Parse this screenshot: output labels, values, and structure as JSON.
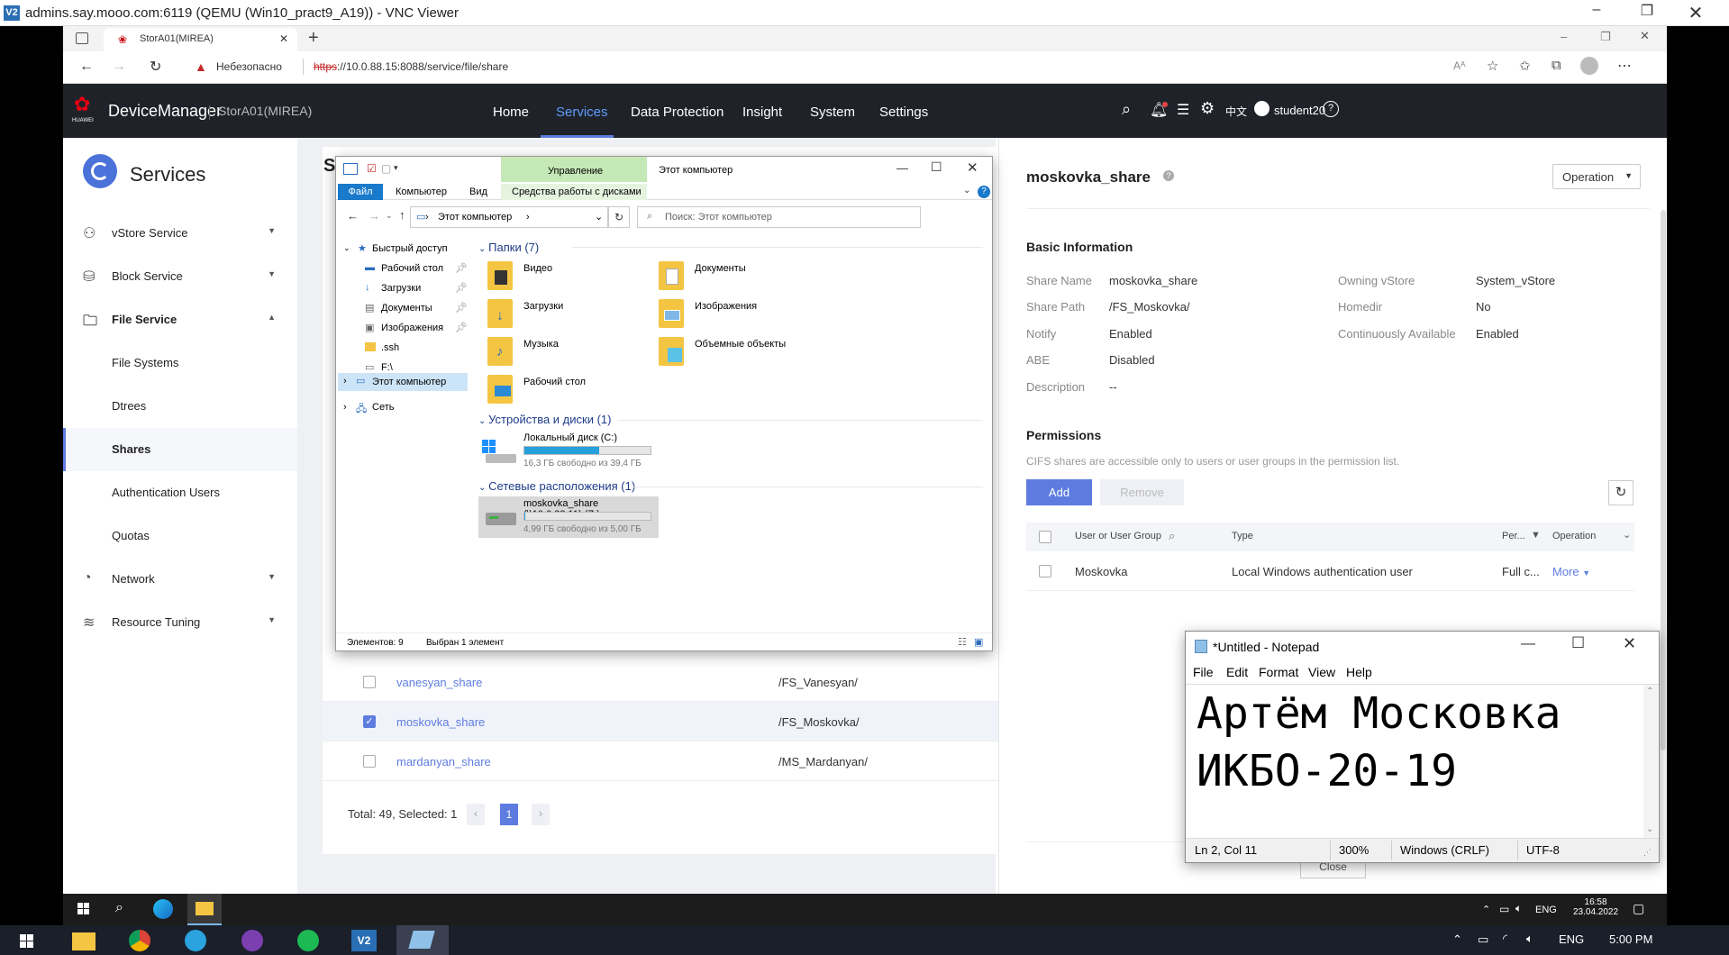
{
  "vnc": {
    "title": "admins.say.mooo.com:6119 (QEMU (Win10_pract9_A19)) - VNC Viewer",
    "icon": "V2"
  },
  "browser": {
    "tab_title": "StorA01(MIREA)",
    "security_label": "Небезопасно",
    "url_scheme": "https",
    "url_rest": "://10.0.88.15:8088/service/file/share"
  },
  "header": {
    "brand": "DeviceManager",
    "huawei": "HUAWEI",
    "device": "StorA01(MIREA)",
    "nav": [
      "Home",
      "Services",
      "Data Protection",
      "Insight",
      "System",
      "Settings"
    ],
    "active_nav": "Services",
    "lang": "中文",
    "user": "student20"
  },
  "sidebar": {
    "title": "Services",
    "items": [
      {
        "label": "vStore Service",
        "icon": "users-icon"
      },
      {
        "label": "Block Service",
        "icon": "database-icon"
      },
      {
        "label": "File Service",
        "icon": "file-icon"
      },
      {
        "label": "File Systems"
      },
      {
        "label": "Dtrees"
      },
      {
        "label": "Shares"
      },
      {
        "label": "Authentication Users"
      },
      {
        "label": "Quotas"
      },
      {
        "label": "Network",
        "icon": "network-icon"
      },
      {
        "label": "Resource Tuning",
        "icon": "layers-icon"
      }
    ]
  },
  "shares": {
    "title_fragment": "Sl",
    "rows": [
      {
        "name": "vanesyan_share",
        "path": "/FS_Vanesyan/",
        "checked": false
      },
      {
        "name": "moskovka_share",
        "path": "/FS_Moskovka/",
        "checked": true
      },
      {
        "name": "mardanyan_share",
        "path": "/MS_Mardanyan/",
        "checked": false
      }
    ],
    "total": "Total: 49, Selected: 1",
    "page": "1"
  },
  "detail": {
    "title": "moskovka_share",
    "operation": "Operation",
    "basic_heading": "Basic Information",
    "fields": [
      {
        "k": "Share Name",
        "v": "moskovka_share"
      },
      {
        "k": "Share Path",
        "v": "/FS_Moskovka/"
      },
      {
        "k": "Notify",
        "v": "Enabled"
      },
      {
        "k": "ABE",
        "v": "Disabled"
      },
      {
        "k": "Description",
        "v": "--"
      }
    ],
    "fields_right": [
      {
        "k": "Owning vStore",
        "v": "System_vStore"
      },
      {
        "k": "Homedir",
        "v": "No"
      },
      {
        "k": "Continuously Available",
        "v": "Enabled"
      }
    ],
    "perm_heading": "Permissions",
    "perm_note": "CIFS shares are accessible only to users or user groups in the permission list.",
    "add": "Add",
    "remove": "Remove",
    "table_headers": [
      "User or User Group",
      "Type",
      "Per...",
      "Operation"
    ],
    "perm_row": {
      "user": "Moskovka",
      "type": "Local Windows authentication user",
      "perm": "Full c...",
      "op": "More"
    },
    "close": "Close"
  },
  "explorer": {
    "title": "Этот компьютер",
    "manage_tab": "Управление",
    "ribbon_tabs": [
      "Файл",
      "Компьютер",
      "Вид"
    ],
    "disk_tools": "Средства работы с дисками",
    "breadcrumb": "Этот компьютер",
    "search_placeholder": "Поиск: Этот компьютер",
    "nav_tree": [
      "Быстрый доступ",
      "Рабочий стол",
      "Загрузки",
      "Документы",
      "Изображения",
      ".ssh",
      "F:\\",
      "Этот компьютер",
      "Сеть"
    ],
    "folders_heading": "Папки (7)",
    "folders": [
      "Видео",
      "Документы",
      "Загрузки",
      "Изображения",
      "Музыка",
      "Объемные объекты",
      "Рабочий стол"
    ],
    "devices_heading": "Устройства и диски (1)",
    "disk_c": {
      "name": "Локальный диск (C:)",
      "free": "16,3 ГБ свободно из 39,4 ГБ",
      "used_fraction": 0.59
    },
    "network_heading": "Сетевые расположения (1)",
    "disk_z": {
      "name": "moskovka_share (\\\\10.0.88.11) (Z:)",
      "free": "4,99 ГБ свободно из 5,00 ГБ",
      "used_fraction": 0.002
    },
    "status_items": "Элементов: 9",
    "status_selected": "Выбран 1 элемент"
  },
  "notepad": {
    "title": "*Untitled - Notepad",
    "menu": [
      "File",
      "Edit",
      "Format",
      "View",
      "Help"
    ],
    "line1": "Артём Московка",
    "line2": "ИКБО-20-19",
    "status": [
      "Ln 2, Col 11",
      "300%",
      "Windows (CRLF)",
      "UTF-8"
    ]
  },
  "taskbar_inner": {
    "lang": "ENG",
    "time": "16:58",
    "date": "23.04.2022"
  },
  "taskbar_outer": {
    "lang": "ENG",
    "time": "5:00 PM"
  },
  "colors": {
    "accent": "#5e7ce0",
    "header_bg": "#1f2329",
    "ribbon_green": "#c5e8b7"
  }
}
